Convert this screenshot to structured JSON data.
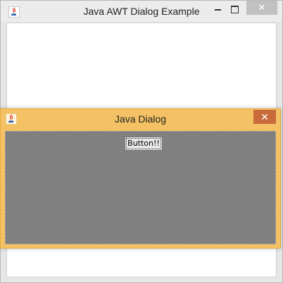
{
  "main_window": {
    "title": "Java AWT Dialog Example",
    "icon": "java-cup-icon",
    "close_glyph": "✕"
  },
  "dialog": {
    "title": "Java Dialog",
    "icon": "java-cup-icon",
    "close_glyph": "✕",
    "button_label": "Button!!"
  },
  "colors": {
    "dialog_frame": "#f4c264",
    "dialog_close": "#c86a3a",
    "dialog_body": "#808080"
  }
}
